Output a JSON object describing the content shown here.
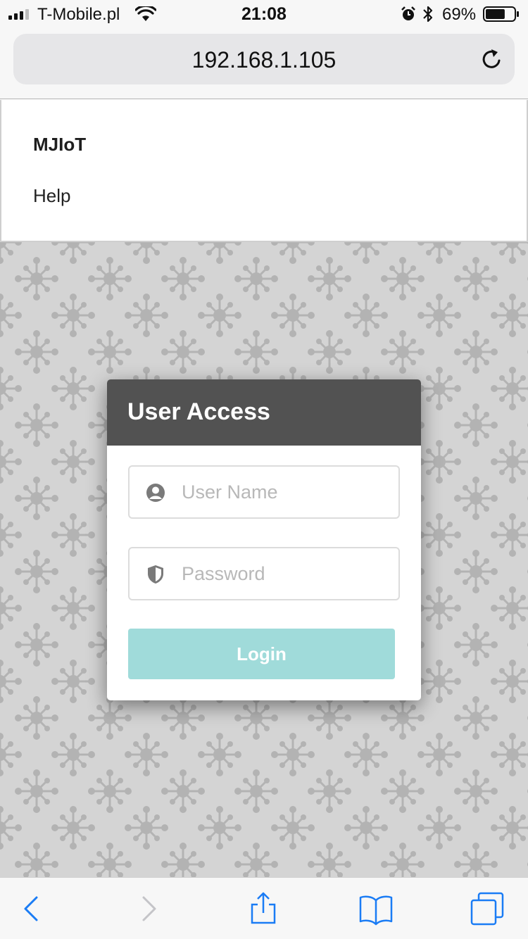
{
  "status_bar": {
    "carrier": "T-Mobile.pl",
    "time": "21:08",
    "battery_percent": "69%",
    "battery_level": 0.69,
    "icons": [
      "signal-icon",
      "wifi-icon",
      "alarm-icon",
      "bluetooth-icon",
      "battery-icon"
    ]
  },
  "browser": {
    "url": "192.168.1.105",
    "reload_icon": "reload-icon",
    "toolbar_icons": [
      "back-icon",
      "forward-icon",
      "share-icon",
      "bookmarks-icon",
      "tabs-icon"
    ],
    "accent_color": "#1a7cf5",
    "disabled_color": "#c4c4c8"
  },
  "page": {
    "brand": "MJIoT",
    "nav": {
      "help": "Help"
    }
  },
  "login": {
    "title": "User Access",
    "username_placeholder": "User Name",
    "password_placeholder": "Password",
    "button_label": "Login",
    "header_color": "#525252",
    "button_color": "#a0dbda"
  }
}
